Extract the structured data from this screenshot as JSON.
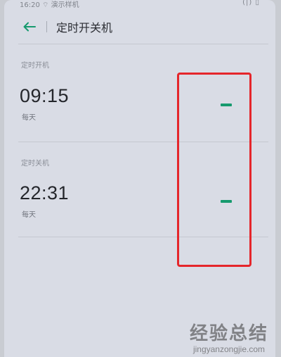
{
  "status_bar": {
    "left_text": "16:20  ⌔ 演示样机",
    "right_icons": "(|) ▯"
  },
  "header": {
    "title": "定时开关机"
  },
  "sections": [
    {
      "title": "定时开机",
      "time": "09:15",
      "repeat": "每天",
      "toggle_state": "on"
    },
    {
      "title": "定时关机",
      "time": "22:31",
      "repeat": "每天",
      "toggle_state": "on"
    }
  ],
  "colors": {
    "accent": "#169a6e",
    "highlight": "#e5262b"
  },
  "watermark": {
    "main": "经验总结",
    "url": "jingyanzongjie.com"
  }
}
